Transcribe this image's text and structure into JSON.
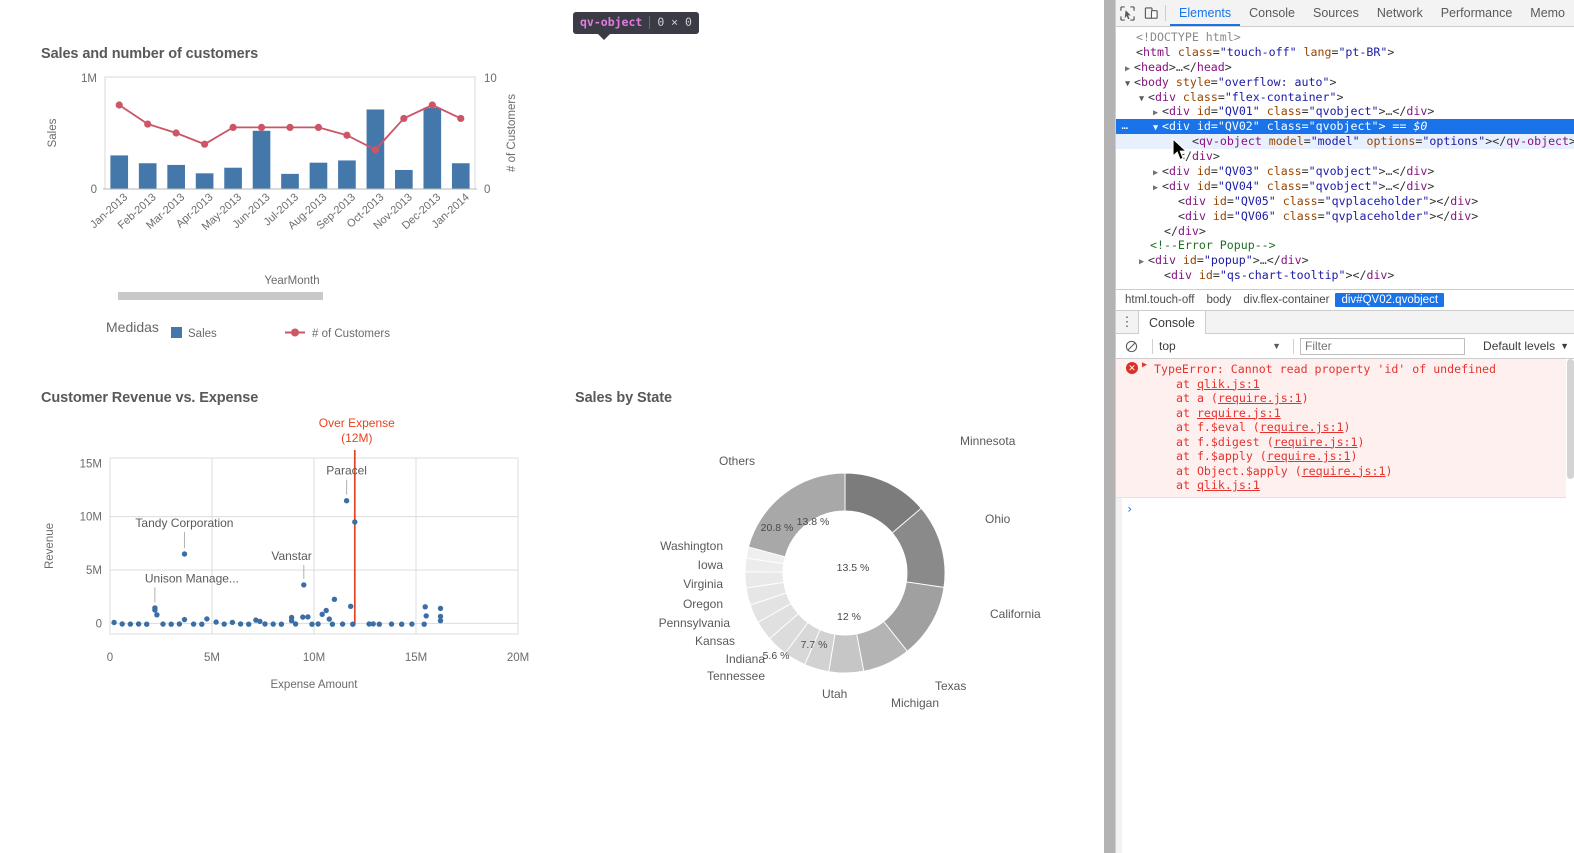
{
  "inspector_badge": {
    "tag": "qv-object",
    "dimensions": "0 × 0"
  },
  "charts": {
    "bar_line": {
      "title": "Sales and number of customers",
      "dimension_label": "YearMonth",
      "legend_group_label": "Medidas",
      "legend": [
        {
          "label": "Sales",
          "color": "#4477aa",
          "marker": "square"
        },
        {
          "label": "# of Customers",
          "color": "#cc5566",
          "marker": "line-dot"
        }
      ]
    },
    "scatter": {
      "title": "Customer Revenue vs. Expense"
    },
    "donut": {
      "title": "Sales by State"
    }
  },
  "chart_data": [
    {
      "type": "bar",
      "title": "Sales and number of customers",
      "xlabel": "YearMonth",
      "ylabel": "Sales",
      "y2label": "# of Customers",
      "ylim": [
        0,
        1000000
      ],
      "y2lim": [
        0,
        10
      ],
      "ytick_labels": [
        "0",
        "1M"
      ],
      "y2tick_labels": [
        "0",
        "10"
      ],
      "grid": false,
      "legend": "bottom",
      "categories": [
        "Jan-2013",
        "Feb-2013",
        "Mar-2013",
        "Apr-2013",
        "May-2013",
        "Jun-2013",
        "Jul-2013",
        "Aug-2013",
        "Sep-2013",
        "Oct-2013",
        "Nov-2013",
        "Dec-2013",
        "Jan-2014"
      ],
      "series": [
        {
          "name": "Sales",
          "kind": "bar",
          "axis": "left",
          "color": "#4477aa",
          "values": [
            300000,
            230000,
            215000,
            140000,
            190000,
            520000,
            135000,
            235000,
            255000,
            710000,
            170000,
            725000,
            230000
          ]
        },
        {
          "name": "# of Customers",
          "kind": "line",
          "axis": "right",
          "color": "#cc5566",
          "values": [
            7.5,
            5.8,
            5.0,
            4.0,
            5.5,
            5.5,
            5.5,
            5.5,
            4.8,
            3.5,
            6.3,
            7.5,
            6.3
          ]
        }
      ]
    },
    {
      "type": "scatter",
      "title": "Customer Revenue vs. Expense",
      "xlabel": "Expense Amount",
      "ylabel": "Revenue",
      "xlim": [
        0,
        20000000
      ],
      "ylim": [
        -1000000,
        15500000
      ],
      "xtick_labels": [
        "0",
        "5M",
        "10M",
        "15M",
        "20M"
      ],
      "ytick_labels": [
        "0",
        "5M",
        "10M",
        "15M"
      ],
      "grid": true,
      "point_color": "#3b6ea5",
      "reference_line": {
        "label": "Over Expense",
        "value_label": "(12M)",
        "value": 12000000,
        "color": "#e8431f"
      },
      "annotations": [
        {
          "label": "Paracel",
          "x": 11600000,
          "y": 11500000
        },
        {
          "label": "Tandy Corporation",
          "x": 3650000,
          "y": 6500000
        },
        {
          "label": "Vanstar",
          "x": 9500000,
          "y": 3600000
        },
        {
          "label": "Unison Manage...",
          "x": 2200000,
          "y": 1400000
        }
      ],
      "points": [
        [
          11600000,
          11500000
        ],
        [
          12000000,
          9500000
        ],
        [
          3650000,
          6500000
        ],
        [
          9500000,
          3600000
        ],
        [
          11000000,
          2250000
        ],
        [
          11800000,
          1600000
        ],
        [
          2200000,
          1450000
        ],
        [
          2200000,
          1250000
        ],
        [
          2300000,
          800000
        ],
        [
          15450000,
          1550000
        ],
        [
          16200000,
          1400000
        ],
        [
          15500000,
          700000
        ],
        [
          16200000,
          650000
        ],
        [
          16200000,
          250000
        ],
        [
          10600000,
          1200000
        ],
        [
          10400000,
          850000
        ],
        [
          10750000,
          400000
        ],
        [
          9700000,
          600000
        ],
        [
          9450000,
          580000
        ],
        [
          8900000,
          550000
        ],
        [
          8900000,
          250000
        ],
        [
          4750000,
          420000
        ],
        [
          3650000,
          350000
        ],
        [
          7150000,
          300000
        ],
        [
          7350000,
          180000
        ],
        [
          5200000,
          120000
        ],
        [
          6000000,
          90000
        ],
        [
          200000,
          80000
        ],
        [
          600000,
          -60000
        ],
        [
          1000000,
          -70000
        ],
        [
          1400000,
          -60000
        ],
        [
          1800000,
          -80000
        ],
        [
          2600000,
          -70000
        ],
        [
          3000000,
          -80000
        ],
        [
          3400000,
          -60000
        ],
        [
          4100000,
          -70000
        ],
        [
          4500000,
          -80000
        ],
        [
          5600000,
          -70000
        ],
        [
          6400000,
          -60000
        ],
        [
          6800000,
          -80000
        ],
        [
          7600000,
          -60000
        ],
        [
          8000000,
          -70000
        ],
        [
          8400000,
          -80000
        ],
        [
          9100000,
          -60000
        ],
        [
          9900000,
          -80000
        ],
        [
          10200000,
          -60000
        ],
        [
          10900000,
          -80000
        ],
        [
          11400000,
          -70000
        ],
        [
          11900000,
          -80000
        ],
        [
          12700000,
          -60000
        ],
        [
          13200000,
          -80000
        ],
        [
          13800000,
          -70000
        ],
        [
          14300000,
          -80000
        ],
        [
          14800000,
          -70000
        ],
        [
          15400000,
          -80000
        ],
        [
          12900000,
          -50000
        ]
      ]
    },
    {
      "type": "pie",
      "subtype": "donut",
      "title": "Sales by State",
      "labels": [
        "Minnesota",
        "Ohio",
        "California",
        "Texas",
        "Michigan",
        "Utah",
        "Tennessee",
        "Indiana",
        "Kansas",
        "Pennsylvania",
        "Oregon",
        "Virginia",
        "Iowa",
        "Washington",
        "Others"
      ],
      "values": [
        13.8,
        13.5,
        12.0,
        7.7,
        5.6,
        4.0,
        3.6,
        3.4,
        3.2,
        3.0,
        2.8,
        2.6,
        2.2,
        1.8,
        20.8
      ],
      "value_labels": [
        "13.8 %",
        "13.5 %",
        "12 %",
        "7.7 %",
        "5.6 %",
        "",
        "",
        "",
        "",
        "",
        "",
        "",
        "",
        "",
        "20.8 %"
      ],
      "colors": [
        "#7c7c7c",
        "#8a8a8a",
        "#a0a0a0",
        "#b4b4b4",
        "#c6c6c6",
        "#d2d2d2",
        "#d8d8d8",
        "#dcdcdc",
        "#e0e0e0",
        "#e3e3e3",
        "#e6e6e6",
        "#e9e9e9",
        "#ececec",
        "#efefef",
        "#a8a8a8"
      ]
    }
  ],
  "devtools": {
    "toolbar": {
      "inspect_icon": "inspect-element-icon",
      "device_icon": "device-toolbar-icon",
      "tabs": [
        {
          "label": "Elements",
          "active": true
        },
        {
          "label": "Console",
          "active": false
        },
        {
          "label": "Sources",
          "active": false
        },
        {
          "label": "Network",
          "active": false
        },
        {
          "label": "Performance",
          "active": false
        },
        {
          "label": "Memo",
          "active": false
        }
      ]
    },
    "dom_lines": [
      {
        "indent": 1,
        "tri": "",
        "html": "<span class=\"c-doctype\">&lt;!DOCTYPE html&gt;</span>"
      },
      {
        "indent": 1,
        "tri": "",
        "html": "<span class=\"c-punc\">&lt;</span><span class=\"c-tag\">html</span> <span class=\"c-attr\">class</span><span class=\"c-punc\">=</span><span class=\"c-val\">\"touch-off\"</span> <span class=\"c-attr\">lang</span><span class=\"c-punc\">=</span><span class=\"c-val\">\"pt-BR\"</span><span class=\"c-punc\">&gt;</span>"
      },
      {
        "indent": 1,
        "tri": "closed",
        "html": "<span class=\"c-punc\">&lt;</span><span class=\"c-tag\">head</span><span class=\"c-punc\">&gt;</span><span class=\"c-text\">…</span><span class=\"c-punc\">&lt;/</span><span class=\"c-tag\">head</span><span class=\"c-punc\">&gt;</span>"
      },
      {
        "indent": 1,
        "tri": "open",
        "html": "<span class=\"c-punc\">&lt;</span><span class=\"c-tag\">body</span> <span class=\"c-attr\">style</span><span class=\"c-punc\">=</span><span class=\"c-val\">\"overflow: auto\"</span><span class=\"c-punc\">&gt;</span>"
      },
      {
        "indent": 2,
        "tri": "open",
        "html": "<span class=\"c-punc\">&lt;</span><span class=\"c-tag\">div</span> <span class=\"c-attr\">class</span><span class=\"c-punc\">=</span><span class=\"c-val\">\"flex-container\"</span><span class=\"c-punc\">&gt;</span>"
      },
      {
        "indent": 3,
        "tri": "closed",
        "html": "<span class=\"c-punc\">&lt;</span><span class=\"c-tag\">div</span> <span class=\"c-attr\">id</span><span class=\"c-punc\">=</span><span class=\"c-val\">\"QV01\"</span> <span class=\"c-attr\">class</span><span class=\"c-punc\">=</span><span class=\"c-val\">\"qvobject\"</span><span class=\"c-punc\">&gt;</span><span class=\"c-text\">…</span><span class=\"c-punc\">&lt;/</span><span class=\"c-tag\">div</span><span class=\"c-punc\">&gt;</span>"
      },
      {
        "indent": 3,
        "tri": "open",
        "state": "selected",
        "gutter": "…",
        "html": "<span class=\"c-punc\">&lt;</span><span class=\"c-tag\">div</span> <span class=\"c-attr\">id</span><span class=\"c-punc\">=</span><span class=\"c-val\">\"QV02\"</span> <span class=\"c-attr\">class</span><span class=\"c-punc\">=</span><span class=\"c-val\">\"qvobject\"</span><span class=\"c-punc\">&gt;</span> <span class=\"c-sel\">== $0</span>"
      },
      {
        "indent": 5,
        "tri": "",
        "state": "childsel",
        "html": "<span class=\"c-punc\">&lt;</span><span class=\"c-tag\">qv-object</span> <span class=\"c-attr\">model</span><span class=\"c-punc\">=</span><span class=\"c-val\">\"model\"</span> <span class=\"c-attr\">options</span><span class=\"c-punc\">=</span><span class=\"c-val\">\"options\"</span><span class=\"c-punc\">&gt;&lt;/</span><span class=\"c-tag\">qv-object</span><span class=\"c-punc\">&gt;</span>"
      },
      {
        "indent": 4,
        "tri": "",
        "html": "<span class=\"c-punc\">&lt;/</span><span class=\"c-tag\">div</span><span class=\"c-punc\">&gt;</span>"
      },
      {
        "indent": 3,
        "tri": "closed",
        "html": "<span class=\"c-punc\">&lt;</span><span class=\"c-tag\">div</span> <span class=\"c-attr\">id</span><span class=\"c-punc\">=</span><span class=\"c-val\">\"QV03\"</span> <span class=\"c-attr\">class</span><span class=\"c-punc\">=</span><span class=\"c-val\">\"qvobject\"</span><span class=\"c-punc\">&gt;</span><span class=\"c-text\">…</span><span class=\"c-punc\">&lt;/</span><span class=\"c-tag\">div</span><span class=\"c-punc\">&gt;</span>"
      },
      {
        "indent": 3,
        "tri": "closed",
        "html": "<span class=\"c-punc\">&lt;</span><span class=\"c-tag\">div</span> <span class=\"c-attr\">id</span><span class=\"c-punc\">=</span><span class=\"c-val\">\"QV04\"</span> <span class=\"c-attr\">class</span><span class=\"c-punc\">=</span><span class=\"c-val\">\"qvobject\"</span><span class=\"c-punc\">&gt;</span><span class=\"c-text\">…</span><span class=\"c-punc\">&lt;/</span><span class=\"c-tag\">div</span><span class=\"c-punc\">&gt;</span>"
      },
      {
        "indent": 4,
        "tri": "",
        "html": "<span class=\"c-punc\">&lt;</span><span class=\"c-tag\">div</span> <span class=\"c-attr\">id</span><span class=\"c-punc\">=</span><span class=\"c-val\">\"QV05\"</span> <span class=\"c-attr\">class</span><span class=\"c-punc\">=</span><span class=\"c-val\">\"qvplaceholder\"</span><span class=\"c-punc\">&gt;&lt;/</span><span class=\"c-tag\">div</span><span class=\"c-punc\">&gt;</span>"
      },
      {
        "indent": 4,
        "tri": "",
        "html": "<span class=\"c-punc\">&lt;</span><span class=\"c-tag\">div</span> <span class=\"c-attr\">id</span><span class=\"c-punc\">=</span><span class=\"c-val\">\"QV06\"</span> <span class=\"c-attr\">class</span><span class=\"c-punc\">=</span><span class=\"c-val\">\"qvplaceholder\"</span><span class=\"c-punc\">&gt;&lt;/</span><span class=\"c-tag\">div</span><span class=\"c-punc\">&gt;</span>"
      },
      {
        "indent": 3,
        "tri": "",
        "html": "<span class=\"c-punc\">&lt;/</span><span class=\"c-tag\">div</span><span class=\"c-punc\">&gt;</span>"
      },
      {
        "indent": 2,
        "tri": "",
        "html": "<span class=\"c-comment\">&lt;!--Error Popup--&gt;</span>"
      },
      {
        "indent": 2,
        "tri": "closed",
        "html": "<span class=\"c-punc\">&lt;</span><span class=\"c-tag\">div</span> <span class=\"c-attr\">id</span><span class=\"c-punc\">=</span><span class=\"c-val\">\"popup\"</span><span class=\"c-punc\">&gt;</span><span class=\"c-text\">…</span><span class=\"c-punc\">&lt;/</span><span class=\"c-tag\">div</span><span class=\"c-punc\">&gt;</span>"
      },
      {
        "indent": 3,
        "tri": "",
        "html": "<span class=\"c-punc\">&lt;</span><span class=\"c-tag\">div</span> <span class=\"c-attr\">id</span><span class=\"c-punc\">=</span><span class=\"c-val\">\"qs-chart-tooltip\"</span><span class=\"c-punc\">&gt;&lt;/</span><span class=\"c-tag\">div</span><span class=\"c-punc\">&gt;</span>"
      }
    ],
    "breadcrumbs": [
      {
        "label": "html.touch-off",
        "active": false
      },
      {
        "label": "body",
        "active": false
      },
      {
        "label": "div.flex-container",
        "active": false
      },
      {
        "label": "div#QV02.qvobject",
        "active": true
      }
    ],
    "console": {
      "drawer_tab": "Console",
      "clear_icon": "clear-console-icon",
      "context": "top",
      "filter_placeholder": "Filter",
      "levels": "Default levels",
      "prompt": "›",
      "error": {
        "message": "TypeError: Cannot read property 'id' of undefined",
        "stack": [
          {
            "prefix": "at ",
            "fn": "",
            "link": "qlik.js:1",
            "paren": false
          },
          {
            "prefix": "at ",
            "fn": "a ",
            "link": "require.js:1",
            "paren": true
          },
          {
            "prefix": "at ",
            "fn": "",
            "link": "require.js:1",
            "paren": false
          },
          {
            "prefix": "at ",
            "fn": "f.$eval ",
            "link": "require.js:1",
            "paren": true
          },
          {
            "prefix": "at ",
            "fn": "f.$digest ",
            "link": "require.js:1",
            "paren": true
          },
          {
            "prefix": "at ",
            "fn": "f.$apply ",
            "link": "require.js:1",
            "paren": true
          },
          {
            "prefix": "at ",
            "fn": "Object.$apply ",
            "link": "require.js:1",
            "paren": true
          },
          {
            "prefix": "at ",
            "fn": "",
            "link": "qlik.js:1",
            "paren": false
          }
        ]
      }
    }
  }
}
